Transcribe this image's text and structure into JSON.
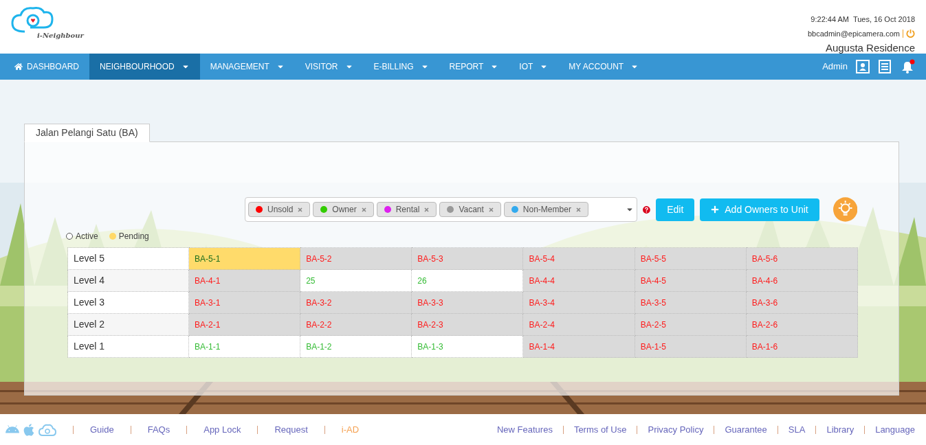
{
  "header": {
    "logo_text": "i-Neighbour",
    "datetime": "9:22:44 AM  Tues, 16 Oct 2018",
    "email": "bbcadmin@epicamera.com",
    "residence": "Augusta Residence"
  },
  "nav": {
    "items": [
      {
        "label": "DASHBOARD",
        "selected": false,
        "dropdown": false,
        "kind": "home"
      },
      {
        "label": "NEIGHBOURHOOD",
        "selected": true,
        "dropdown": true
      },
      {
        "label": "MANAGEMENT",
        "selected": false,
        "dropdown": true
      },
      {
        "label": "VISITOR",
        "selected": false,
        "dropdown": true
      },
      {
        "label": "E-BILLING",
        "selected": false,
        "dropdown": true
      },
      {
        "label": "REPORT",
        "selected": false,
        "dropdown": true
      },
      {
        "label": "IOT",
        "selected": false,
        "dropdown": true
      },
      {
        "label": "MY ACCOUNT",
        "selected": false,
        "dropdown": true
      }
    ],
    "user": "Admin",
    "notification_dot": true
  },
  "tabs": [
    {
      "label": "Jalan Pelangi Satu (BA)",
      "selected": true
    }
  ],
  "filter": {
    "tags": [
      {
        "label": "Unsold",
        "color": "#ff0000"
      },
      {
        "label": "Owner",
        "color": "#33cc00"
      },
      {
        "label": "Rental",
        "color": "#dd22ee"
      },
      {
        "label": "Vacant",
        "color": "#999999"
      },
      {
        "label": "Non-Member",
        "color": "#33aaee"
      }
    ],
    "edit_button": "Edit",
    "add_button": "Add Owners to Unit"
  },
  "legend": [
    {
      "label": "Active",
      "kind": "active"
    },
    {
      "label": "Pending",
      "kind": "pending"
    }
  ],
  "levels": [
    {
      "label": "Level 5",
      "units": [
        {
          "label": "BA-5-1",
          "kind": "owner",
          "pending": true
        },
        {
          "label": "BA-5-2",
          "kind": "unsold",
          "pending": false
        },
        {
          "label": "BA-5-3",
          "kind": "unsold",
          "pending": false
        },
        {
          "label": "BA-5-4",
          "kind": "unsold",
          "pending": false
        },
        {
          "label": "BA-5-5",
          "kind": "unsold",
          "pending": false
        },
        {
          "label": "BA-5-6",
          "kind": "unsold",
          "pending": false
        }
      ]
    },
    {
      "label": "Level 4",
      "units": [
        {
          "label": "BA-4-1",
          "kind": "unsold",
          "pending": false
        },
        {
          "label": "25",
          "kind": "owner",
          "pending": false
        },
        {
          "label": "26",
          "kind": "owner",
          "pending": false
        },
        {
          "label": "BA-4-4",
          "kind": "unsold",
          "pending": false
        },
        {
          "label": "BA-4-5",
          "kind": "unsold",
          "pending": false
        },
        {
          "label": "BA-4-6",
          "kind": "unsold",
          "pending": false
        }
      ]
    },
    {
      "label": "Level 3",
      "units": [
        {
          "label": "BA-3-1",
          "kind": "unsold",
          "pending": false
        },
        {
          "label": "BA-3-2",
          "kind": "unsold",
          "pending": false
        },
        {
          "label": "BA-3-3",
          "kind": "unsold",
          "pending": false
        },
        {
          "label": "BA-3-4",
          "kind": "unsold",
          "pending": false
        },
        {
          "label": "BA-3-5",
          "kind": "unsold",
          "pending": false
        },
        {
          "label": "BA-3-6",
          "kind": "unsold",
          "pending": false
        }
      ]
    },
    {
      "label": "Level 2",
      "units": [
        {
          "label": "BA-2-1",
          "kind": "unsold",
          "pending": false
        },
        {
          "label": "BA-2-2",
          "kind": "unsold",
          "pending": false
        },
        {
          "label": "BA-2-3",
          "kind": "unsold",
          "pending": false
        },
        {
          "label": "BA-2-4",
          "kind": "unsold",
          "pending": false
        },
        {
          "label": "BA-2-5",
          "kind": "unsold",
          "pending": false
        },
        {
          "label": "BA-2-6",
          "kind": "unsold",
          "pending": false
        }
      ]
    },
    {
      "label": "Level 1",
      "units": [
        {
          "label": "BA-1-1",
          "kind": "owner",
          "pending": false
        },
        {
          "label": "BA-1-2",
          "kind": "owner",
          "pending": false
        },
        {
          "label": "BA-1-3",
          "kind": "owner",
          "pending": false
        },
        {
          "label": "BA-1-4",
          "kind": "unsold",
          "pending": false
        },
        {
          "label": "BA-1-5",
          "kind": "unsold",
          "pending": false
        },
        {
          "label": "BA-1-6",
          "kind": "unsold",
          "pending": false
        }
      ]
    }
  ],
  "footer": {
    "left_links": [
      {
        "label": "Guide",
        "kind": "link"
      },
      {
        "label": "FAQs",
        "kind": "link"
      },
      {
        "label": "App Lock",
        "kind": "link"
      },
      {
        "label": "Request",
        "kind": "link"
      },
      {
        "label": "i-AD",
        "kind": "promo"
      }
    ],
    "right_links": [
      "New Features",
      "Terms of Use",
      "Privacy Policy",
      "Guarantee",
      "SLA",
      "Library",
      "Language"
    ]
  }
}
